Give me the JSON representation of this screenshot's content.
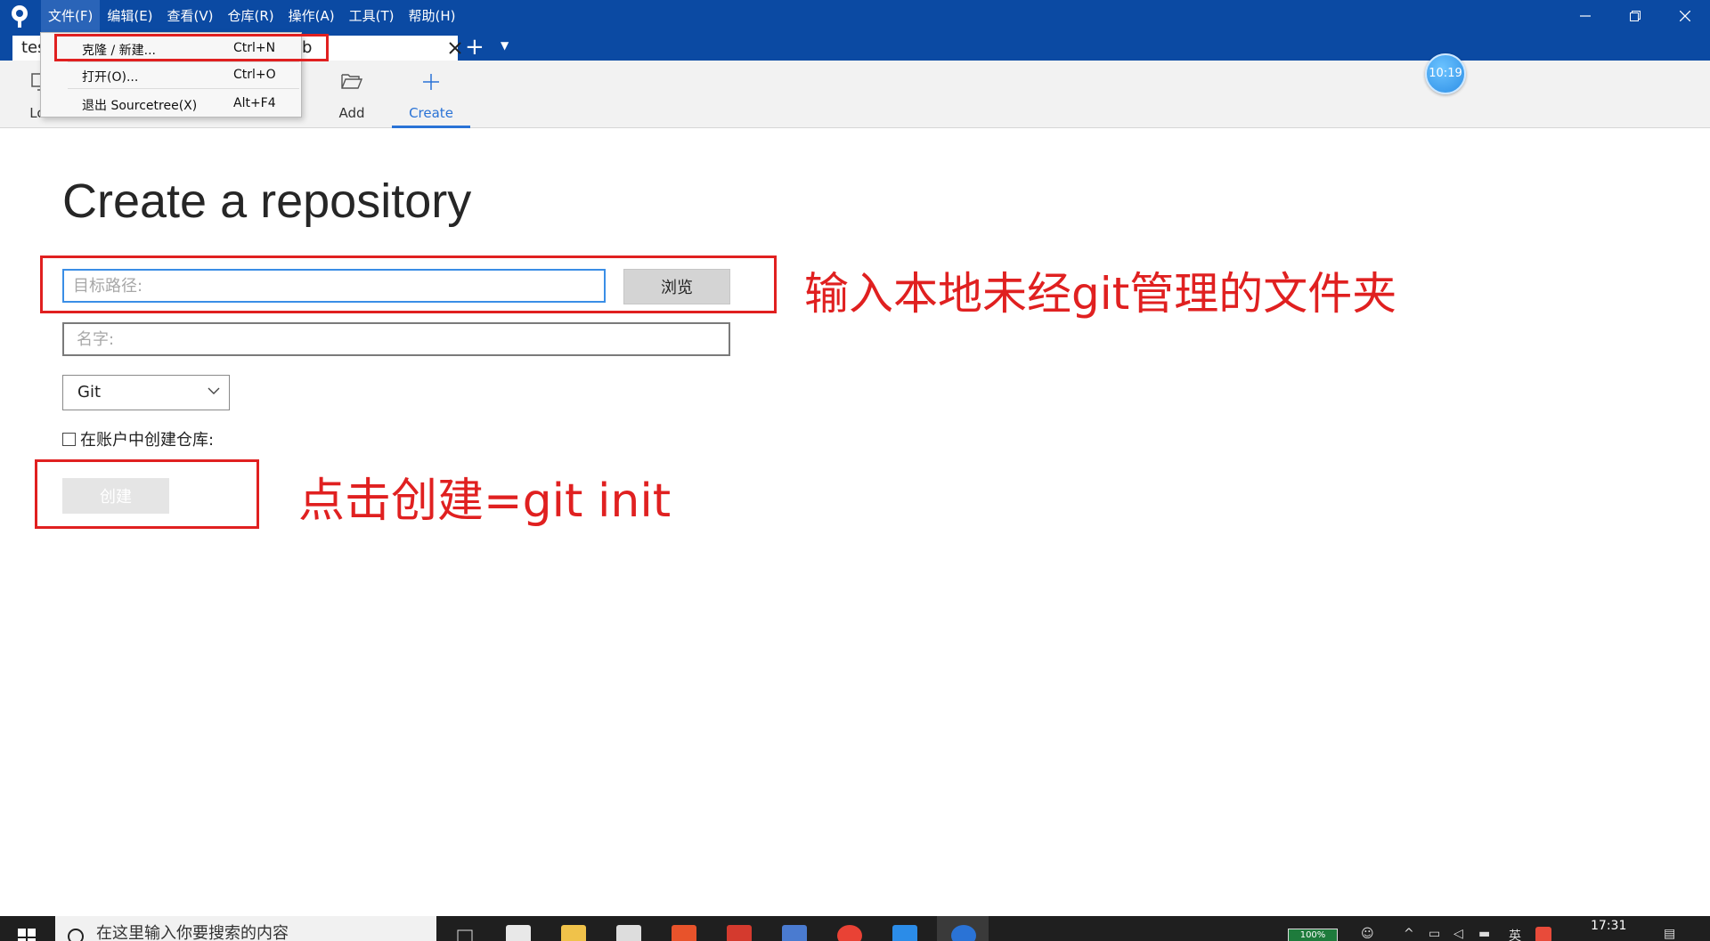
{
  "menubar": {
    "items": [
      "文件(F)",
      "编辑(E)",
      "查看(V)",
      "仓库(R)",
      "操作(A)",
      "工具(T)",
      "帮助(H)"
    ]
  },
  "tabs": {
    "current_label_start": "tes",
    "current_label_end": "b"
  },
  "file_menu": {
    "items": [
      {
        "label": "克隆 / 新建...",
        "shortcut": "Ctrl+N"
      },
      {
        "label": "打开(O)...",
        "shortcut": "Ctrl+O"
      },
      {
        "label": "退出 Sourcetree(X)",
        "shortcut": "Alt+F4"
      }
    ]
  },
  "toolbar": {
    "local_label": "Loc",
    "add_label": "Add",
    "create_label": "Create"
  },
  "timer_badge": "10:19",
  "main": {
    "title": "Create a repository",
    "path_placeholder": "目标路径:",
    "browse_label": "浏览",
    "name_placeholder": "名字:",
    "vcs_selected": "Git",
    "account_checkbox_label": "在账户中创建仓库:",
    "create_label": "创建"
  },
  "annotations": {
    "path_note": "输入本地未经git管理的文件夹",
    "create_note": "点击创建=git init"
  },
  "taskbar": {
    "search_text": "在这里输入你要搜索的内容",
    "battery": "100%",
    "ime": "英",
    "clock": "17:31"
  },
  "colors": {
    "titlebar": "#0b4aa3",
    "annotation_red": "#e02020",
    "accent_blue": "#2a73d6"
  }
}
